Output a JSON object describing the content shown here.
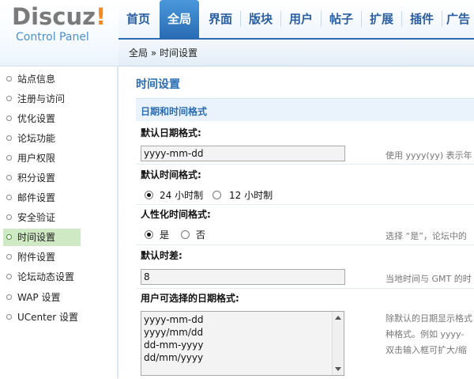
{
  "logo": {
    "part1": "Discuz",
    "part2": "!",
    "subtitle": "Control Panel"
  },
  "nav": [
    {
      "label": "首页"
    },
    {
      "label": "全局"
    },
    {
      "label": "界面"
    },
    {
      "label": "版块"
    },
    {
      "label": "用户"
    },
    {
      "label": "帖子"
    },
    {
      "label": "扩展"
    },
    {
      "label": "插件"
    },
    {
      "label": "广告"
    }
  ],
  "breadcrumb": "全局 » 时间设置",
  "sidebar": [
    {
      "label": "站点信息"
    },
    {
      "label": "注册与访问"
    },
    {
      "label": "优化设置"
    },
    {
      "label": "论坛功能"
    },
    {
      "label": "用户权限"
    },
    {
      "label": "积分设置"
    },
    {
      "label": "邮件设置"
    },
    {
      "label": "安全验证"
    },
    {
      "label": "时间设置"
    },
    {
      "label": "附件设置"
    },
    {
      "label": "论坛动态设置"
    },
    {
      "label": "WAP 设置"
    },
    {
      "label": "UCenter 设置"
    }
  ],
  "page": {
    "title": "时间设置",
    "section": "日期和时间格式",
    "date_format": {
      "label": "默认日期格式:",
      "value": "yyyy-mm-dd",
      "help": "使用 yyyy(yy) 表示年"
    },
    "time_format": {
      "label": "默认时间格式:",
      "opt1": "24 小时制",
      "opt2": "12 小时制"
    },
    "humanize": {
      "label": "人性化时间格式:",
      "opt1": "是",
      "opt2": "否",
      "help": "选择 “是”，论坛中的"
    },
    "timezone": {
      "label": "默认时差:",
      "value": "8",
      "help": "当地时间与 GMT 的时"
    },
    "user_formats": {
      "label": "用户可选择的日期格式:",
      "lines": [
        "yyyy-mm-dd",
        "yyyy/mm/dd",
        "dd-mm-yyyy",
        "dd/mm/yyyy"
      ],
      "help1": "除默认的日期显示格式",
      "help2": "种格式。例如 yyyy-",
      "help3": "双击输入框可扩大/缩"
    }
  }
}
